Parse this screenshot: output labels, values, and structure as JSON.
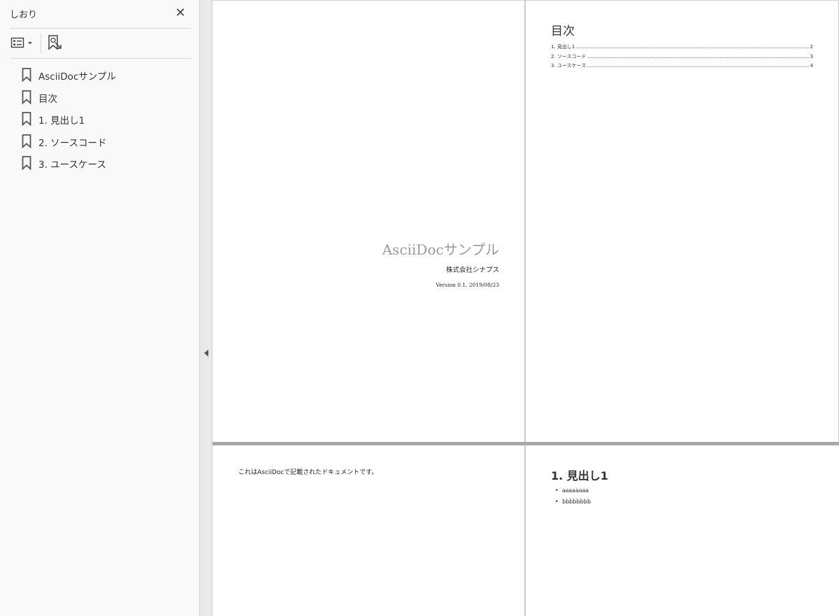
{
  "panel": {
    "title": "しおり",
    "close_label": "✕",
    "bookmarks": [
      {
        "label": "AsciiDocサンプル"
      },
      {
        "label": "目次"
      },
      {
        "label": "1. 見出し1"
      },
      {
        "label": "2. ソースコード"
      },
      {
        "label": "3. ユースケース"
      }
    ]
  },
  "pages": {
    "cover": {
      "title": "AsciiDocサンプル",
      "company": "株式会社シナプス",
      "version": "Version 0.1, 2019/08/23"
    },
    "toc": {
      "title": "目次",
      "entries": [
        {
          "label": "1. 見出し1",
          "page": "2"
        },
        {
          "label": "2. ソースコード",
          "page": "3"
        },
        {
          "label": "3. ユースケース",
          "page": "4"
        }
      ]
    },
    "intro": {
      "text": "これはAsciiDocで記載されたドキュメントです。"
    },
    "section1": {
      "heading": "1. 見出し1",
      "bullets": [
        "aaaaaaaa",
        "bbbbbbbb"
      ]
    }
  },
  "colors": {
    "panel_bg": "#f9f9f9",
    "cover_title": "#9a9a9a",
    "page_divider": "#a8a8a8"
  }
}
